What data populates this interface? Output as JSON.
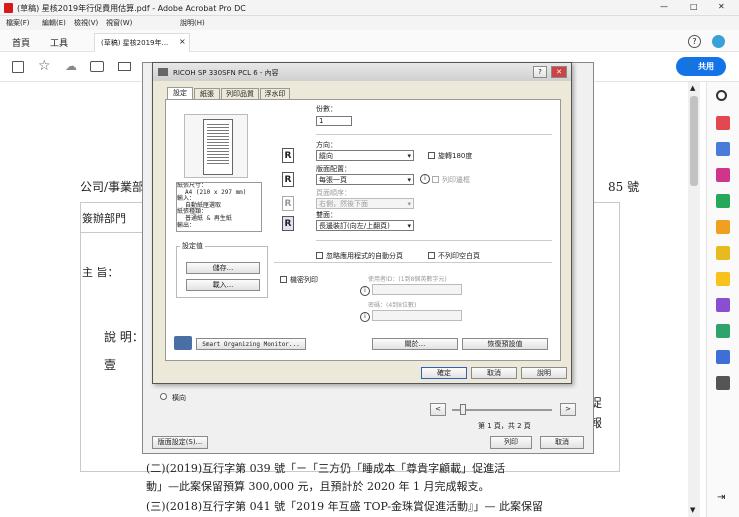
{
  "window": {
    "title": "(草稿) 星核2019年行促費用估算.pdf - Adobe Acrobat Pro DC",
    "min": "—",
    "max": "□",
    "close": "✕"
  },
  "menu": [
    "檔案(F)",
    "編輯(E)",
    "檢視(V)",
    "視窗(W)",
    "說明(H)"
  ],
  "tabs": {
    "home": "首頁",
    "tools": "工具",
    "doc": "(草稿) 星核2019年...",
    "close": "×"
  },
  "share": "共用",
  "doc": {
    "line_company": "公司/事業部",
    "line_number": "85 號",
    "dept": "簽辦部門",
    "subject": "主 旨：",
    "explain": "說 明：",
    "one": "壹",
    "p1": "(二)(2019)互行字第 039 號「ㄧ「三方仍「睡成本「尊貴字顧載」促進活",
    "p2": "動」—此案保留預算 300,000 元，且預計於 2020 年 1 月完成報支。",
    "p3": "(三)(2018)互行字第 041 號「2019 年互盛 TOP-金珠賞促進活動』」— 此案保留",
    "right1": "促",
    "right2": "報"
  },
  "print_panel": {
    "orientation": "橫向",
    "page_status": "第 1 頁，共 2 頁",
    "page_setup": "版面設定(S)...",
    "print": "列印",
    "cancel": "取消",
    "prev": "<",
    "next": ">"
  },
  "dialog": {
    "title": "RICOH SP 330SFN PCL 6 - 內容",
    "tabs": [
      "設定",
      "紙張",
      "列印品質",
      "浮水印"
    ],
    "info": [
      "紙張尺寸：",
      "A4 (210 x 297 mm)",
      "輸入：",
      "自動紙匣選取",
      "紙張種類：",
      "普通紙 & 再生紙",
      "輸出："
    ],
    "settings_group": "設定值",
    "save": "儲存...",
    "load": "載入...",
    "copies_label": "份數：",
    "copies_value": "1",
    "orientation_label": "方向：",
    "orientation_value": "縱向",
    "rotate": "旋轉180度",
    "layout_label": "版面配置：",
    "layout_value": "每張一頁",
    "border": "列印邊框",
    "page_order_label": "頁面順序：",
    "page_order_value": "右側，然後下面",
    "duplex_label": "雙面：",
    "duplex_value": "長邊裝訂(向左/上翻頁)",
    "ignore_auto": "忽略應用程式的自動分頁",
    "no_blank": "不列印空白頁",
    "secure": "機密列印",
    "user_id": "使用者ID：(1到8個英數字元)",
    "password": "密碼：(4到8位數)",
    "monitor": "Smart Organizing Monitor...",
    "about": "關於...",
    "restore": "恢復預設值",
    "ok": "確定",
    "cancel": "取消",
    "help": "說明",
    "help_icon": "?",
    "close_icon": "✕"
  },
  "colors": {
    "accent": "#1473e6",
    "dialog_bg": "#ece9d8",
    "adobe_red": "#d7191c"
  }
}
